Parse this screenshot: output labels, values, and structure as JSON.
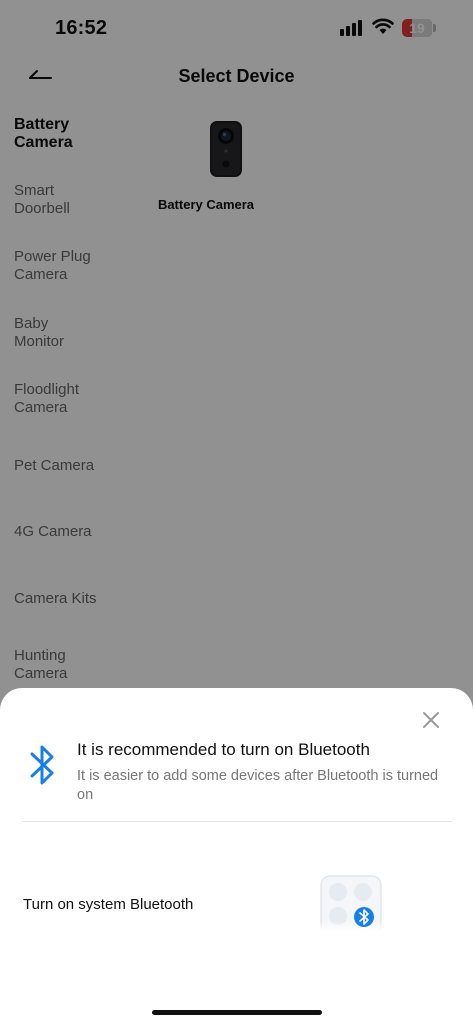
{
  "status_bar": {
    "time": "16:52",
    "battery": "19"
  },
  "header": {
    "title": "Select Device"
  },
  "sidebar": {
    "items": [
      {
        "label": "Battery Camera",
        "lines": [
          "Battery",
          "Camera"
        ]
      },
      {
        "label": "Smart Doorbell",
        "lines": [
          "Smart",
          "Doorbell"
        ]
      },
      {
        "label": "Power Plug Camera",
        "lines": [
          "Power Plug",
          "Camera"
        ]
      },
      {
        "label": "Baby Monitor",
        "lines": [
          "Baby",
          "Monitor"
        ]
      },
      {
        "label": "Floodlight Camera",
        "lines": [
          "Floodlight",
          "Camera"
        ]
      },
      {
        "label": "Pet Camera",
        "lines": [
          "Pet Camera"
        ]
      },
      {
        "label": "4G Camera",
        "lines": [
          "4G Camera"
        ]
      },
      {
        "label": "Camera Kits",
        "lines": [
          "Camera Kits"
        ]
      },
      {
        "label": "Hunting Camera",
        "lines": [
          "Hunting",
          "Camera"
        ]
      }
    ]
  },
  "devices": [
    {
      "label": "Battery Camera"
    }
  ],
  "sheet": {
    "title": "It is recommended to turn on Bluetooth",
    "subtitle": "It is easier to add some devices after Bluetooth is turned on",
    "option_label": "Turn on system Bluetooth"
  },
  "colors": {
    "accent": "#1a7fe0",
    "battery_low": "#e03a3a"
  },
  "icons": [
    "back-arrow-icon",
    "camera-device-icon",
    "close-icon",
    "bluetooth-icon",
    "bluetooth-settings-icon"
  ]
}
